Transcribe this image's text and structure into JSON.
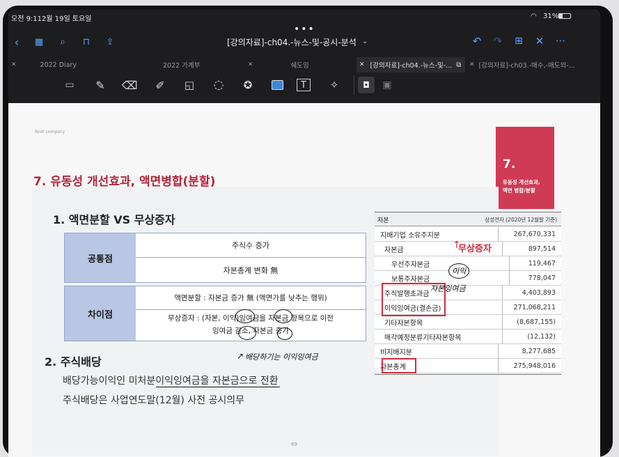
{
  "status": {
    "time": "오전 9:11",
    "date": "2월 19일 토요일",
    "battery": "31%"
  },
  "title": "[강의자료]-ch04.-뉴스-및-공시-분석",
  "tabs": [
    {
      "label": "2022 Diary"
    },
    {
      "label": "2022 가계부"
    },
    {
      "label": "쉐도잉"
    },
    {
      "label": "[강의자료]-ch04.-뉴스-및-..."
    },
    {
      "label": "[강의자료]-ch03.-매수,-매도의-..."
    }
  ],
  "slide": {
    "brand": "Root company",
    "heading": "7. 유동성 개선효과, 액면병합(분할)",
    "corner_num": "7.",
    "corner_title": "유동성 개선효과,",
    "corner_title2": "액면 병합/분할",
    "sec1_title": "1.  액면분할 VS 무상증자",
    "common_label": "공통점",
    "common_1": "주식수 증가",
    "common_2": "자본총계 변화 無",
    "diff_label": "차이점",
    "diff_1": "액면분할 : 자본금 증가 無 (액면가를 낮추는 행위)",
    "diff_2a": "무상증자 : (자본, 이익)잉여금을 자본금 항목으로 이전",
    "diff_2b": "잉여금 감소, 자본금 증가",
    "sec2_title": "2. 주식배당",
    "sec2_line1": "배당가능이익인 미처분이익잉여금을 자본금으로 전환",
    "sec2_line2": "주식배당은 사업연도말(12월) 사전 공시의무",
    "page_no": "69",
    "table_head_left": "자본",
    "table_head_right": "삼성전자 (2020년 12월말 기준)",
    "table_rows": [
      {
        "label": "지배기업 소유주지분",
        "value": "267,670,331"
      },
      {
        "label": "자본금",
        "value": "897,514"
      },
      {
        "label": "우선주자본금",
        "value": "119,467"
      },
      {
        "label": "보통주자본금",
        "value": "778,047"
      },
      {
        "label": "주식발행초과금",
        "value": "4,403,893"
      },
      {
        "label": "이익잉여금(결손금)",
        "value": "271,068,211"
      },
      {
        "label": "기타자본항목",
        "value": "(8,687,155)"
      },
      {
        "label": "매각예정분류기타자본항목",
        "value": "(12,132)"
      },
      {
        "label": "비지배지분",
        "value": "8,277,685"
      },
      {
        "label": "자본총계",
        "value": "275,948,016"
      }
    ],
    "annot_mushang": "무상증자",
    "annot_hw1": "자본잉여금",
    "annot_hw2": "이익",
    "annot_hw3": "배당하기는 이익잉여금"
  }
}
